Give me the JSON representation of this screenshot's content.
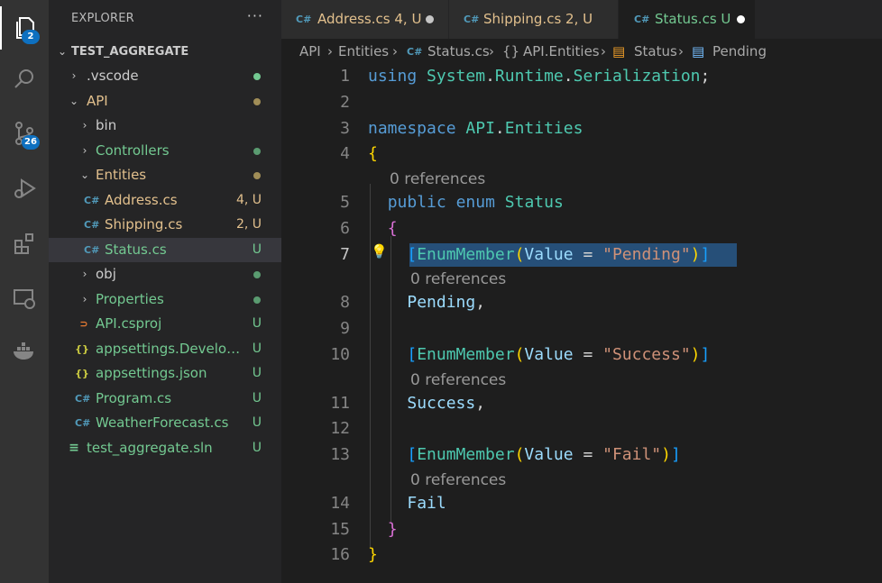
{
  "activity_bar": {
    "explorer_badge": "2",
    "source_control_badge": "26"
  },
  "sidebar": {
    "title": "EXPLORER",
    "more": "···",
    "root": "TEST_AGGREGATE",
    "items": [
      {
        "label": ".vscode",
        "status": ""
      },
      {
        "label": "API",
        "status": ""
      },
      {
        "label": "bin",
        "status": ""
      },
      {
        "label": "Controllers",
        "status": ""
      },
      {
        "label": "Entities",
        "status": ""
      },
      {
        "label": "Address.cs",
        "status": "4, U",
        "icon": "C#"
      },
      {
        "label": "Shipping.cs",
        "status": "2, U",
        "icon": "C#"
      },
      {
        "label": "Status.cs",
        "status": "U",
        "icon": "C#"
      },
      {
        "label": "obj",
        "status": ""
      },
      {
        "label": "Properties",
        "status": ""
      },
      {
        "label": "API.csproj",
        "status": "U",
        "icon": "rss"
      },
      {
        "label": "appsettings.Develop...",
        "status": "U",
        "icon": "{}"
      },
      {
        "label": "appsettings.json",
        "status": "U",
        "icon": "{}"
      },
      {
        "label": "Program.cs",
        "status": "U",
        "icon": "C#"
      },
      {
        "label": "WeatherForecast.cs",
        "status": "U",
        "icon": "C#"
      },
      {
        "label": "test_aggregate.sln",
        "status": "U",
        "icon": "≡"
      }
    ]
  },
  "tabs": [
    {
      "icon": "C#",
      "name": "Address.cs",
      "status": "4, U"
    },
    {
      "icon": "C#",
      "name": "Shipping.cs",
      "status": "2, U"
    },
    {
      "icon": "C#",
      "name": "Status.cs",
      "status": "U"
    }
  ],
  "breadcrumb": [
    "API",
    "Entities",
    "Status.cs",
    "API.Entities",
    "Status",
    "Pending"
  ],
  "editor": {
    "line_numbers": [
      "1",
      "2",
      "3",
      "4",
      "5",
      "6",
      "7",
      "8",
      "9",
      "10",
      "11",
      "12",
      "13",
      "14",
      "15",
      "16"
    ],
    "current_line": "7",
    "code": {
      "using": "using",
      "sys": "System",
      "runtime": "Runtime",
      "serialization": "Serialization",
      "namespace": "namespace",
      "api": "API",
      "entities": "Entities",
      "public": "public",
      "enum": "enum",
      "status": "Status",
      "enum_member": "EnumMember",
      "value": "Value",
      "str_pending": "\"Pending\"",
      "str_success": "\"Success\"",
      "str_fail": "\"Fail\"",
      "pending": "Pending",
      "success": "Success",
      "fail": "Fail"
    },
    "code_lens": "0 references"
  },
  "colors": {
    "accent": "#0e70c0",
    "modified": "#e2c08d",
    "untracked": "#73c991",
    "selection": "#264f78"
  }
}
